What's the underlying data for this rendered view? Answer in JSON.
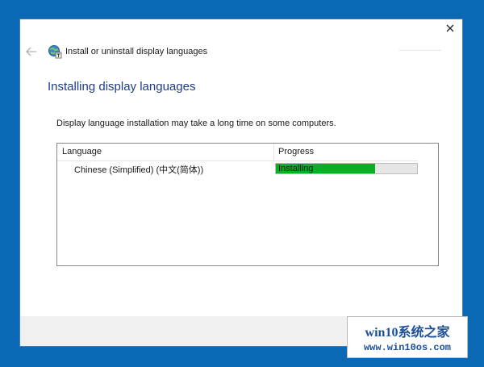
{
  "window": {
    "nav_title": "Install or uninstall display languages",
    "heading": "Installing display languages",
    "notice": "Display language installation may take a long time on some computers."
  },
  "list": {
    "columns": [
      "Language",
      "Progress"
    ],
    "rows": [
      {
        "language": "Chinese (Simplified) (中文(简体))",
        "status": "Installing",
        "progress": 0.7
      }
    ]
  },
  "icons": {
    "close": "close-icon",
    "back": "back-arrow-icon",
    "app": "language-globe-icon"
  },
  "colors": {
    "desktop": "#0a68b4",
    "heading": "#1e3a8c",
    "progress_fill": "#06b025",
    "progress_track": "#e6e6e6"
  },
  "watermark": {
    "title": "win10系统之家",
    "url": "www.win10os.com"
  }
}
